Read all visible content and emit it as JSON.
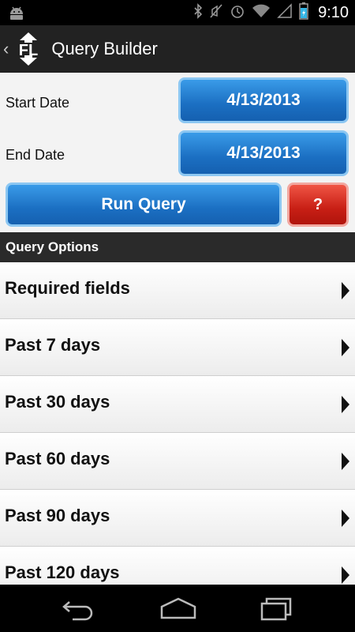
{
  "status_bar": {
    "time": "9:10",
    "icons": [
      "android-icon",
      "bluetooth-icon",
      "mute-icon",
      "alarm-icon",
      "wifi-icon",
      "signal-icon",
      "battery-icon"
    ]
  },
  "action_bar": {
    "title": "Query Builder",
    "logo_text": "FL"
  },
  "form": {
    "start_label": "Start Date",
    "start_value": "4/13/2013",
    "end_label": "End Date",
    "end_value": "4/13/2013",
    "run_label": "Run Query",
    "help_label": "?"
  },
  "options": {
    "header": "Query Options",
    "items": [
      "Required fields",
      "Past 7 days",
      "Past 30 days",
      "Past 60 days",
      "Past 90 days",
      "Past 120 days"
    ]
  },
  "colors": {
    "button_blue": "#1b6fc2",
    "button_red": "#c81f15",
    "header_dark": "#2a2a2a"
  },
  "nav_bar": {
    "icons": [
      "back-icon",
      "home-icon",
      "recent-apps-icon"
    ]
  }
}
